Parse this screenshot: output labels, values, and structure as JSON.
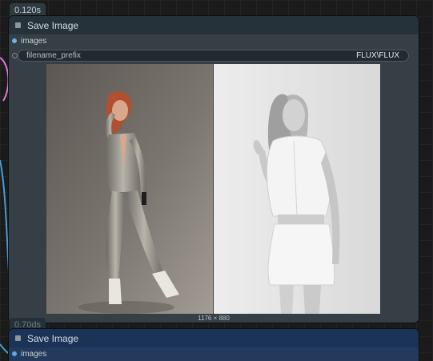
{
  "canvas": {
    "timing_primary": "0.120s",
    "timing_secondary": "0.70ds"
  },
  "main_node": {
    "title": "Save Image",
    "input_slot": "images",
    "widget_label": "filename_prefix",
    "widget_value": "FLUX\\FLUX",
    "preview_dimensions": "1176 × 880",
    "preview_images": [
      {
        "alt": "woman-in-metallic-silver-jumpsuit",
        "icon": "image-thumbnail"
      },
      {
        "alt": "woman-in-white-shirt-and-skirt-monochrome",
        "icon": "image-thumbnail"
      }
    ]
  },
  "secondary_node": {
    "title": "Save Image",
    "input_slot": "images"
  },
  "colors": {
    "node_body": "#353f45",
    "node_title": "#26323a",
    "slot_blue": "#64b5f6",
    "wire_pink": "#d97ad9",
    "second_node_body": "#233a5c"
  }
}
